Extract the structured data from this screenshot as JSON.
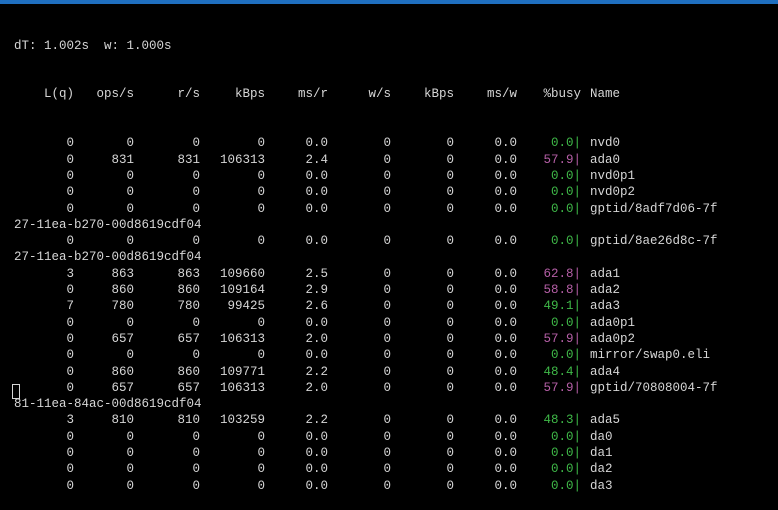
{
  "status_line": "dT: 1.002s  w: 1.000s",
  "header": {
    "lq": "L(q)",
    "ops": "ops/s",
    "rs": "r/s",
    "kbps_r": "kBps",
    "ms_r": "ms/r",
    "ws": "w/s",
    "kbps_w": "kBps",
    "ms_w": "ms/w",
    "busy": "%busy",
    "name": "Name"
  },
  "lines": [
    {
      "type": "row",
      "lq": "0",
      "ops": "0",
      "rs": "0",
      "kr": "0",
      "msr": "0.0",
      "ws": "0",
      "kw": "0",
      "msw": "0.0",
      "busy": "0.0|",
      "level": "low",
      "name": "nvd0"
    },
    {
      "type": "row",
      "lq": "0",
      "ops": "831",
      "rs": "831",
      "kr": "106313",
      "msr": "2.4",
      "ws": "0",
      "kw": "0",
      "msw": "0.0",
      "busy": "57.9|",
      "level": "high",
      "name": "ada0"
    },
    {
      "type": "row",
      "lq": "0",
      "ops": "0",
      "rs": "0",
      "kr": "0",
      "msr": "0.0",
      "ws": "0",
      "kw": "0",
      "msw": "0.0",
      "busy": "0.0|",
      "level": "low",
      "name": "nvd0p1"
    },
    {
      "type": "row",
      "lq": "0",
      "ops": "0",
      "rs": "0",
      "kr": "0",
      "msr": "0.0",
      "ws": "0",
      "kw": "0",
      "msw": "0.0",
      "busy": "0.0|",
      "level": "low",
      "name": "nvd0p2"
    },
    {
      "type": "row",
      "lq": "0",
      "ops": "0",
      "rs": "0",
      "kr": "0",
      "msr": "0.0",
      "ws": "0",
      "kw": "0",
      "msw": "0.0",
      "busy": "0.0|",
      "level": "low",
      "name": "gptid/8adf7d06-7f"
    },
    {
      "type": "wrap",
      "text": "27-11ea-b270-00d8619cdf04"
    },
    {
      "type": "row",
      "lq": "0",
      "ops": "0",
      "rs": "0",
      "kr": "0",
      "msr": "0.0",
      "ws": "0",
      "kw": "0",
      "msw": "0.0",
      "busy": "0.0|",
      "level": "low",
      "name": "gptid/8ae26d8c-7f"
    },
    {
      "type": "wrap",
      "text": "27-11ea-b270-00d8619cdf04"
    },
    {
      "type": "row",
      "lq": "3",
      "ops": "863",
      "rs": "863",
      "kr": "109660",
      "msr": "2.5",
      "ws": "0",
      "kw": "0",
      "msw": "0.0",
      "busy": "62.8|",
      "level": "high",
      "name": "ada1"
    },
    {
      "type": "row",
      "lq": "0",
      "ops": "860",
      "rs": "860",
      "kr": "109164",
      "msr": "2.9",
      "ws": "0",
      "kw": "0",
      "msw": "0.0",
      "busy": "58.8|",
      "level": "high",
      "name": "ada2"
    },
    {
      "type": "row",
      "lq": "7",
      "ops": "780",
      "rs": "780",
      "kr": "99425",
      "msr": "2.6",
      "ws": "0",
      "kw": "0",
      "msw": "0.0",
      "busy": "49.1|",
      "level": "low",
      "name": "ada3"
    },
    {
      "type": "row",
      "lq": "0",
      "ops": "0",
      "rs": "0",
      "kr": "0",
      "msr": "0.0",
      "ws": "0",
      "kw": "0",
      "msw": "0.0",
      "busy": "0.0|",
      "level": "low",
      "name": "ada0p1"
    },
    {
      "type": "row",
      "lq": "0",
      "ops": "657",
      "rs": "657",
      "kr": "106313",
      "msr": "2.0",
      "ws": "0",
      "kw": "0",
      "msw": "0.0",
      "busy": "57.9|",
      "level": "high",
      "name": "ada0p2"
    },
    {
      "type": "row",
      "lq": "0",
      "ops": "0",
      "rs": "0",
      "kr": "0",
      "msr": "0.0",
      "ws": "0",
      "kw": "0",
      "msw": "0.0",
      "busy": "0.0|",
      "level": "low",
      "name": "mirror/swap0.eli"
    },
    {
      "type": "row",
      "lq": "0",
      "ops": "860",
      "rs": "860",
      "kr": "109771",
      "msr": "2.2",
      "ws": "0",
      "kw": "0",
      "msw": "0.0",
      "busy": "48.4|",
      "level": "low",
      "name": "ada4"
    },
    {
      "type": "row",
      "lq": "0",
      "ops": "657",
      "rs": "657",
      "kr": "106313",
      "msr": "2.0",
      "ws": "0",
      "kw": "0",
      "msw": "0.0",
      "busy": "57.9|",
      "level": "high",
      "name": "gptid/70808004-7f"
    },
    {
      "type": "wrap",
      "text": "81-11ea-84ac-00d8619cdf04"
    },
    {
      "type": "row",
      "lq": "3",
      "ops": "810",
      "rs": "810",
      "kr": "103259",
      "msr": "2.2",
      "ws": "0",
      "kw": "0",
      "msw": "0.0",
      "busy": "48.3|",
      "level": "low",
      "name": "ada5"
    },
    {
      "type": "row",
      "lq": "0",
      "ops": "0",
      "rs": "0",
      "kr": "0",
      "msr": "0.0",
      "ws": "0",
      "kw": "0",
      "msw": "0.0",
      "busy": "0.0|",
      "level": "low",
      "name": "da0"
    },
    {
      "type": "row",
      "lq": "0",
      "ops": "0",
      "rs": "0",
      "kr": "0",
      "msr": "0.0",
      "ws": "0",
      "kw": "0",
      "msw": "0.0",
      "busy": "0.0|",
      "level": "low",
      "name": "da1"
    },
    {
      "type": "row",
      "lq": "0",
      "ops": "0",
      "rs": "0",
      "kr": "0",
      "msr": "0.0",
      "ws": "0",
      "kw": "0",
      "msw": "0.0",
      "busy": "0.0|",
      "level": "low",
      "name": "da2"
    },
    {
      "type": "row",
      "lq": "0",
      "ops": "0",
      "rs": "0",
      "kr": "0",
      "msr": "0.0",
      "ws": "0",
      "kw": "0",
      "msw": "0.0",
      "busy": "0.0|",
      "level": "low",
      "name": "da3"
    }
  ],
  "colors": {
    "background": "#000000",
    "foreground": "#d6d6d6",
    "busy_low": "#3fb948",
    "busy_high": "#b55fa6",
    "title_bar": "#1f6fc0"
  }
}
